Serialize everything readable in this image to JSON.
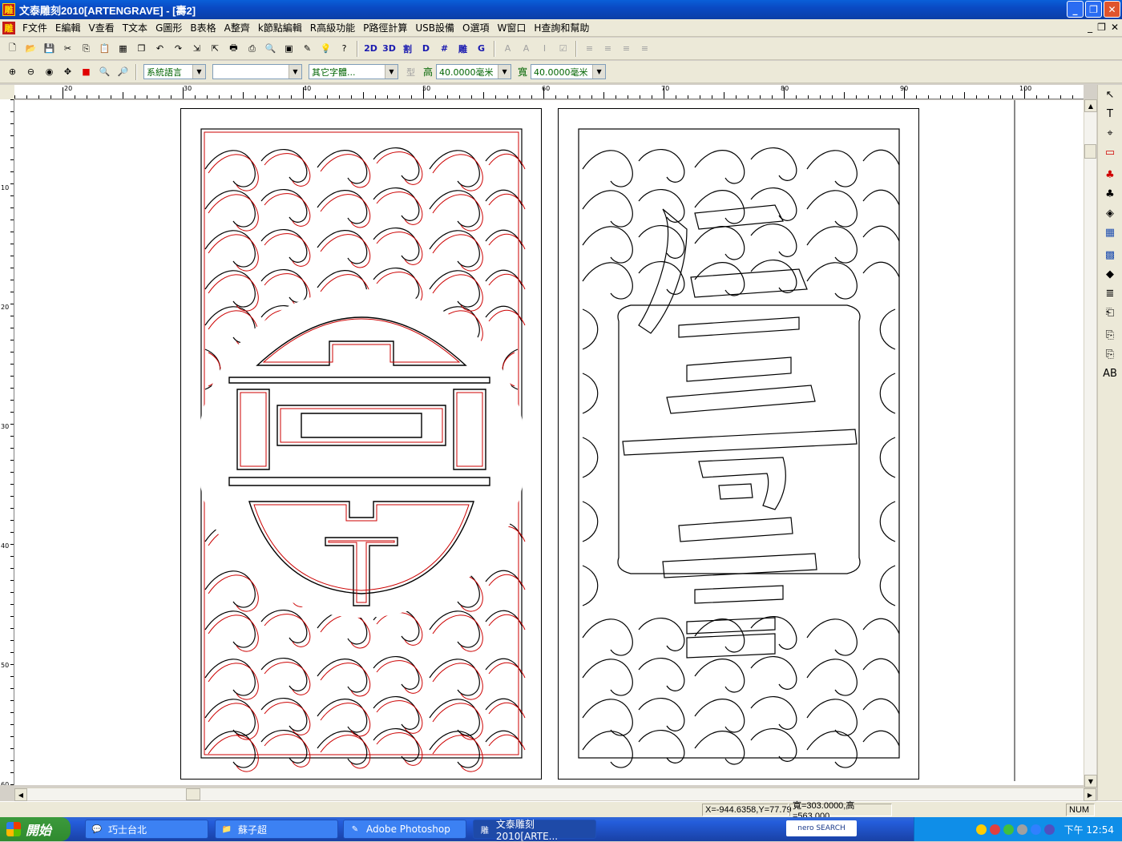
{
  "window": {
    "title": "文泰雕刻2010[ARTENGRAVE] - [壽2]",
    "app_icon_glyph": "雕"
  },
  "menu": {
    "items": [
      "F文件",
      "E編輯",
      "V查看",
      "T文本",
      "G圖形",
      "B表格",
      "A整齊",
      "k節點編輯",
      "R高級功能",
      "P路徑計算",
      "USB設備",
      "O選項",
      "W窗口",
      "H查詢和幫助"
    ]
  },
  "toolbar1": {
    "buttons": [
      {
        "name": "new-icon",
        "glyph": "🗋"
      },
      {
        "name": "open-icon",
        "glyph": "📂"
      },
      {
        "name": "save-icon",
        "glyph": "💾"
      },
      {
        "name": "cut-icon",
        "glyph": "✂"
      },
      {
        "name": "copy-icon",
        "glyph": "⎘"
      },
      {
        "name": "paste-icon",
        "glyph": "📋"
      },
      {
        "name": "paste-special-icon",
        "glyph": "▦"
      },
      {
        "name": "clone-icon",
        "glyph": "❐"
      },
      {
        "name": "undo-icon",
        "glyph": "↶"
      },
      {
        "name": "redo-icon",
        "glyph": "↷"
      },
      {
        "name": "import-icon",
        "glyph": "⇲"
      },
      {
        "name": "export-icon",
        "glyph": "⇱"
      },
      {
        "name": "print-icon",
        "glyph": "🖶"
      },
      {
        "name": "print-setup-icon",
        "glyph": "⎙"
      },
      {
        "name": "preview-icon",
        "glyph": "🔍"
      },
      {
        "name": "frame-icon",
        "glyph": "▣"
      },
      {
        "name": "pen-icon",
        "glyph": "✎"
      },
      {
        "name": "tip-icon",
        "glyph": "💡"
      },
      {
        "name": "help-icon",
        "glyph": "?"
      }
    ],
    "text_buttons": [
      "2D",
      "3D",
      "割",
      "D",
      "#",
      "雕",
      "G"
    ],
    "text_tools": [
      "A",
      "A",
      "I",
      "☑"
    ],
    "align_tools": [
      "≡",
      "≡",
      "≡",
      "≡"
    ]
  },
  "toolbar2": {
    "zoom_buttons": [
      {
        "name": "zoom-in-icon",
        "glyph": "⊕"
      },
      {
        "name": "zoom-out-icon",
        "glyph": "⊖"
      },
      {
        "name": "zoom-page-icon",
        "glyph": "◉"
      },
      {
        "name": "pan-icon",
        "glyph": "✥"
      },
      {
        "name": "color-fill-icon",
        "glyph": "■"
      },
      {
        "name": "zoom-fit-icon",
        "glyph": "🔍"
      },
      {
        "name": "zoom-select-icon",
        "glyph": "🔎"
      }
    ],
    "language_select": "系統語言",
    "font_select": "",
    "other_font_select": "其它字體...",
    "type_glyph": "型",
    "height_label": "高",
    "height_value": "40.0000毫米",
    "width_label": "寬",
    "width_value": "40.0000毫米"
  },
  "ruler": {
    "h_labels": [
      "20",
      "30",
      "40",
      "50",
      "60",
      "70",
      "80",
      "90",
      "100"
    ],
    "v_labels": [
      "10",
      "20",
      "30",
      "40",
      "50",
      "60"
    ]
  },
  "toolbox": {
    "tools": [
      {
        "name": "select-arrow-icon",
        "glyph": "↖"
      },
      {
        "name": "text-tool-icon",
        "glyph": "T"
      },
      {
        "name": "node-edit-icon",
        "glyph": "⌖"
      },
      {
        "name": "rectangle-tool-icon",
        "glyph": "▭"
      },
      {
        "name": "fill-red-icon",
        "glyph": "♣"
      },
      {
        "name": "fill-outline-icon",
        "glyph": "♣"
      },
      {
        "name": "shape-tool-icon",
        "glyph": "◈"
      },
      {
        "name": "table-tool-icon",
        "glyph": "▦"
      },
      {
        "name": "palette-icon",
        "glyph": "▩"
      },
      {
        "name": "bucket-icon",
        "glyph": "◆"
      },
      {
        "name": "paragraph-icon",
        "glyph": "≣"
      },
      {
        "name": "import-doc-icon",
        "glyph": "⎗"
      },
      {
        "name": "copy-doc-icon",
        "glyph": "⎘"
      },
      {
        "name": "copy-doc2-icon",
        "glyph": "⎘"
      },
      {
        "name": "ab-text-icon",
        "glyph": "AB"
      }
    ]
  },
  "status": {
    "coords": "X=-944.6358,Y=77.79",
    "size": "寬=303.0000,高=563.000",
    "num": "NUM"
  },
  "taskbar": {
    "start_label": "開始",
    "tasks": [
      {
        "name": "task-qiaoshi",
        "label": "巧士台北",
        "glyph": "💬"
      },
      {
        "name": "task-folder",
        "label": "蘇子超",
        "glyph": "📁"
      },
      {
        "name": "task-photoshop",
        "label": "Adobe Photoshop",
        "glyph": "✎"
      },
      {
        "name": "task-artengrave",
        "label": "文泰雕刻2010[ARTE...",
        "glyph": "雕"
      }
    ],
    "search_label": "nero SEARCH",
    "clock": "下午 12:54"
  },
  "colors": {
    "cut_path_red": "#cc0000",
    "outline_black": "#000000",
    "titlebar_blue": "#0a4ac4",
    "combo_text_green": "#006400"
  }
}
